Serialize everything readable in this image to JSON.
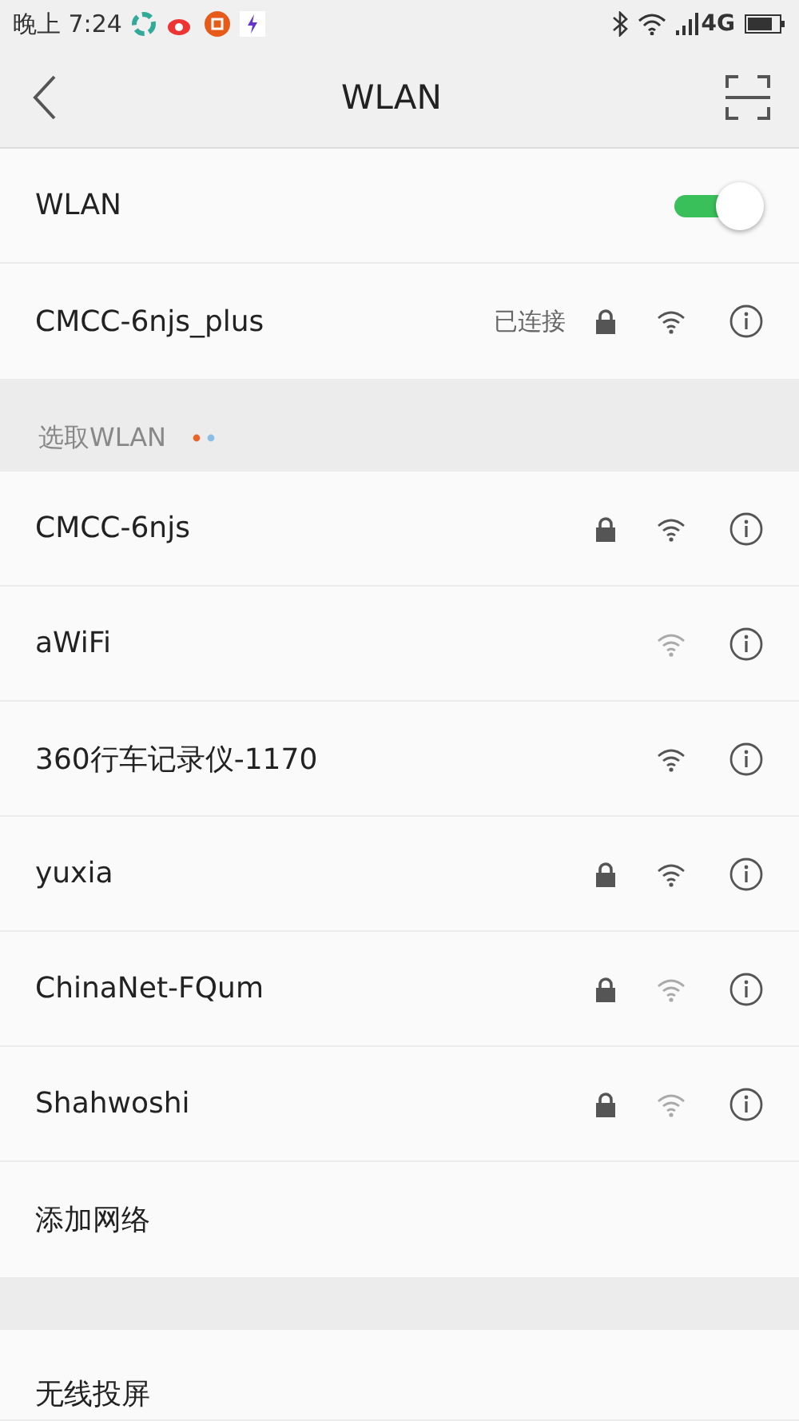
{
  "status_bar": {
    "time": "晚上 7:24",
    "network": "4G"
  },
  "header": {
    "title": "WLAN"
  },
  "wlan_toggle": {
    "label": "WLAN",
    "on": true
  },
  "connected": {
    "name": "CMCC-6njs_plus",
    "status": "已连接",
    "locked": true,
    "strong": true
  },
  "section": {
    "title": "选取WLAN"
  },
  "networks": [
    {
      "name": "CMCC-6njs",
      "locked": true,
      "strong": true
    },
    {
      "name": "aWiFi",
      "locked": false,
      "strong": false
    },
    {
      "name": "360行车记录仪-1170",
      "locked": false,
      "strong": true
    },
    {
      "name": "yuxia",
      "locked": true,
      "strong": true
    },
    {
      "name": "ChinaNet-FQum",
      "locked": true,
      "strong": false
    },
    {
      "name": "Shahwoshi",
      "locked": true,
      "strong": false
    }
  ],
  "add_network": "添加网络",
  "cast": "无线投屏"
}
